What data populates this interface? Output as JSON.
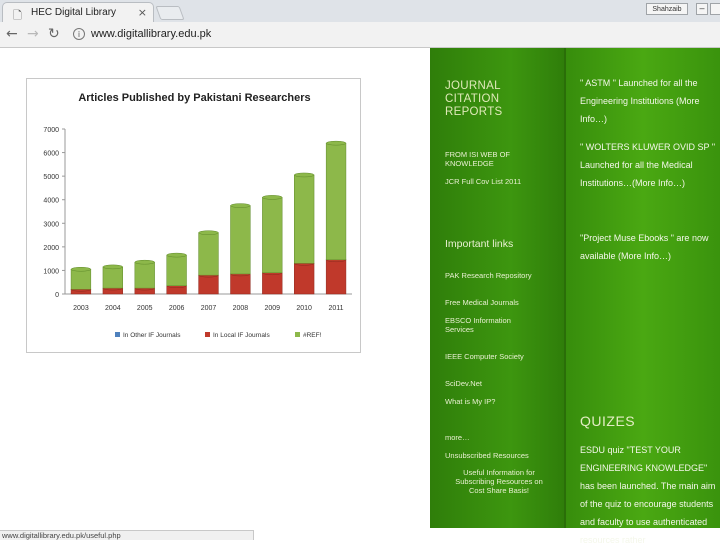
{
  "browser": {
    "tab_title": "HEC Digital Library",
    "tab_close": "×",
    "profile_label": "Shahzaib",
    "url": "www.digitallibrary.edu.pk",
    "status_url": "www.digitallibrary.edu.pk/useful.php"
  },
  "sidebar": {
    "jcr_title": "JOURNAL CITATION REPORTS",
    "jcr_links": [
      "FROM ISI WEB OF KNOWLEDGE",
      "JCR Full Cov List 2011"
    ],
    "important_title": "Important links",
    "important_links": [
      "PAK Research Repository",
      "Free Medical Journals",
      "EBSCO Information Services",
      "IEEE Computer Society",
      "SciDev.Net",
      "What is My IP?"
    ],
    "more_label": "more…",
    "unsubscribed_label": "Unsubscribed Resources",
    "useful_info": "Useful Information for Subscribing Resources on Cost Share Basis!"
  },
  "news": [
    "\" ASTM \" Launched for all the Engineering Institutions (More Info…)",
    "\" WOLTERS KLUWER OVID SP \" Launched for all the Medical Institutions…(More Info…)",
    "\"Project Muse Ebooks \" are now available (More Info…)"
  ],
  "quizzes": {
    "title": "QUIZES",
    "text": "ESDU quiz \"TEST YOUR ENGINEERING KNOWLEDGE\" has been launched. The main aim of the quiz to encourage students and faculty to use authenticated resources rather"
  },
  "colors": {
    "bar_green": "#8db84a",
    "bar_red": "#c0392b",
    "bar_blue": "#4f81bd"
  },
  "chart_data": {
    "type": "bar",
    "title": "Articles Published by Pakistani Researchers",
    "categories": [
      "2003",
      "2004",
      "2005",
      "2006",
      "2007",
      "2008",
      "2009",
      "2010",
      "2011"
    ],
    "series": [
      {
        "name": "In Other IF Journals",
        "values": [
          0,
          0,
          0,
          0,
          0,
          0,
          0,
          0,
          0
        ]
      },
      {
        "name": "In Local IF Journals",
        "values": [
          200,
          250,
          250,
          350,
          800,
          850,
          900,
          1300,
          1450
        ]
      },
      {
        "name": "#REF!",
        "values": [
          850,
          900,
          1100,
          1300,
          1800,
          2900,
          3200,
          3750,
          4950
        ]
      }
    ],
    "stacked": true,
    "ylim": [
      0,
      7000
    ],
    "yticks": [
      0,
      1000,
      2000,
      3000,
      4000,
      5000,
      6000,
      7000
    ],
    "xlabel": "",
    "ylabel": "",
    "legend": "bottom"
  }
}
